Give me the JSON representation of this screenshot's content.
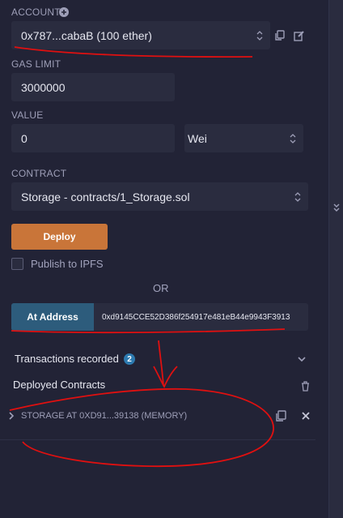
{
  "account": {
    "label": "ACCOUNT",
    "value": "0x787...cabaB (100 ether)",
    "add_icon": "plus-circle-icon",
    "copy_icon": "copy-icon",
    "edit_icon": "edit-icon"
  },
  "gas_limit": {
    "label": "GAS LIMIT",
    "value": "3000000"
  },
  "value": {
    "label": "VALUE",
    "amount": "0",
    "unit": "Wei"
  },
  "contract": {
    "label": "CONTRACT",
    "value": "Storage - contracts/1_Storage.sol"
  },
  "deploy": {
    "button_label": "Deploy",
    "publish_label": "Publish to IPFS",
    "publish_checked": false
  },
  "or_text": "OR",
  "at_address": {
    "button_label": "At Address",
    "input_value": "0xd9145CCE52D386f254917e481eB44e9943F3913"
  },
  "transactions": {
    "label": "Transactions recorded",
    "count": "2"
  },
  "deployed": {
    "label": "Deployed Contracts",
    "instance_label": "STORAGE AT 0XD91...39138 (MEMORY)"
  },
  "colors": {
    "background": "#222336",
    "field": "#2a2c3f",
    "deploy": "#c97539",
    "at_address": "#2d5c7c",
    "badge": "#2d7ab0",
    "annotation": "#e01010"
  }
}
